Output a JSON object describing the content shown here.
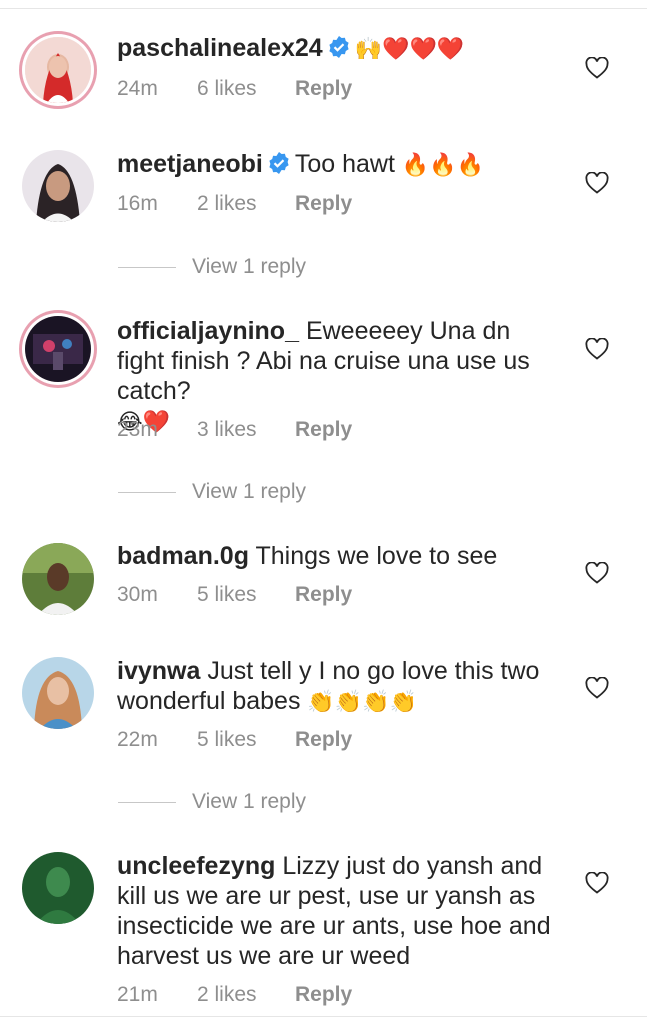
{
  "comments": [
    {
      "username": "paschalinealex24",
      "verified": true,
      "text": "",
      "emojis": "🙌❤️❤️❤️",
      "time": "24m",
      "likes": "6 likes",
      "reply": "Reply"
    },
    {
      "username": "meetjaneobi",
      "verified": true,
      "text": "Too hawt",
      "emojis": "🔥🔥🔥",
      "time": "16m",
      "likes": "2 likes",
      "reply": "Reply",
      "view_replies": "View 1 reply"
    },
    {
      "username": "officialjaynino_",
      "verified": false,
      "text": "Eweeeeey Una dn fight finish ? Abi na cruise una use us catch?",
      "emojis": "😂❤️",
      "time": "23m",
      "likes": "3 likes",
      "reply": "Reply",
      "view_replies": "View 1 reply"
    },
    {
      "username": "badman.0g",
      "verified": false,
      "text": "Things we love to see",
      "emojis": "",
      "time": "30m",
      "likes": "5 likes",
      "reply": "Reply"
    },
    {
      "username": "ivynwa",
      "verified": false,
      "text": "Just tell y I no go love this two wonderful babes",
      "emojis": "👏👏👏👏",
      "time": "22m",
      "likes": "5 likes",
      "reply": "Reply",
      "view_replies": "View 1 reply"
    },
    {
      "username": "uncleefezyng",
      "verified": false,
      "text": "Lizzy just do yansh and kill us we are ur pest, use ur yansh as insecticide we are ur ants, use hoe and harvest us we are ur weed",
      "emojis": "",
      "time": "21m",
      "likes": "2 likes",
      "reply": "Reply"
    }
  ],
  "colors": {
    "text": "#262626",
    "muted": "#8e8e8e",
    "verified": "#3897f0",
    "story_ring": "#e8a0b0"
  },
  "icons": {
    "like": "heart-outline-icon",
    "verified": "verified-badge-icon"
  }
}
